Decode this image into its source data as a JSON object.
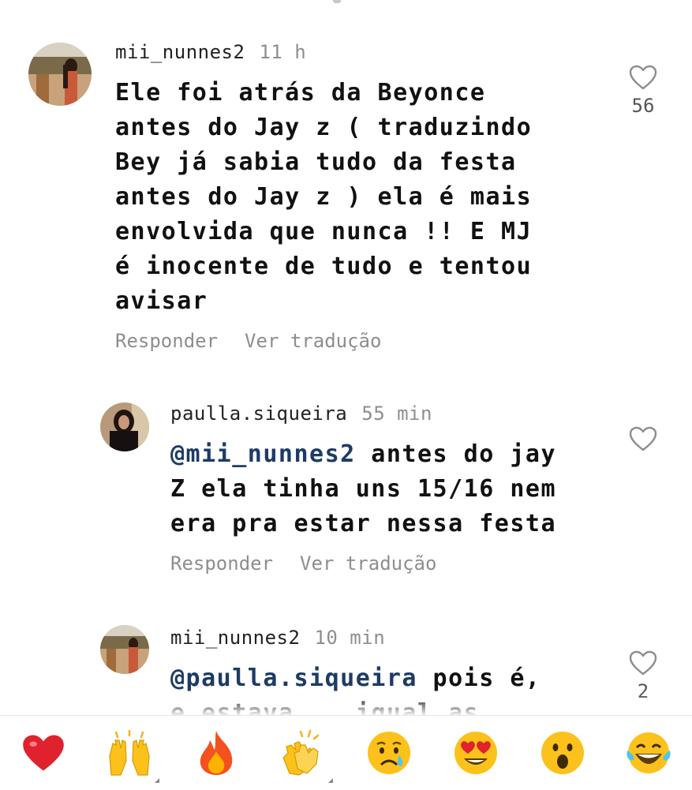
{
  "comments": [
    {
      "username": "mii_nunnes2",
      "time": "11 h",
      "text": "Ele foi atrás da Beyonce\nantes do Jay z ( traduzindo\nBey já sabia tudo da festa\nantes do Jay z ) ela é mais\nenvolvida que nunca !! E MJ\né inocente de tudo e tentou\navisar",
      "reply_label": "Responder",
      "translate_label": "Ver tradução",
      "likes": "56"
    },
    {
      "username": "paulla.siqueira",
      "time": "55 min",
      "mention": "@mii_nunnes2",
      "text": " antes do jay\nZ ela tinha uns 15/16 nem\nera pra estar nessa festa",
      "reply_label": "Responder",
      "translate_label": "Ver tradução"
    },
    {
      "username": "mii_nunnes2",
      "time": "10 min",
      "mention": "@paulla.siqueira",
      "text": " pois é,\ne estava .. igual as",
      "likes": "2"
    }
  ],
  "reactions": [
    {
      "icon": "red-heart-icon",
      "glyph": "❤️"
    },
    {
      "icon": "raising-hands-icon",
      "glyph": "🙌"
    },
    {
      "icon": "fire-icon",
      "glyph": "🔥"
    },
    {
      "icon": "clapping-hands-icon",
      "glyph": "👏"
    },
    {
      "icon": "crying-face-icon",
      "glyph": "😢"
    },
    {
      "icon": "heart-eyes-icon",
      "glyph": "😍"
    },
    {
      "icon": "surprised-face-icon",
      "glyph": "😮"
    },
    {
      "icon": "tears-of-joy-icon",
      "glyph": "😂"
    }
  ]
}
